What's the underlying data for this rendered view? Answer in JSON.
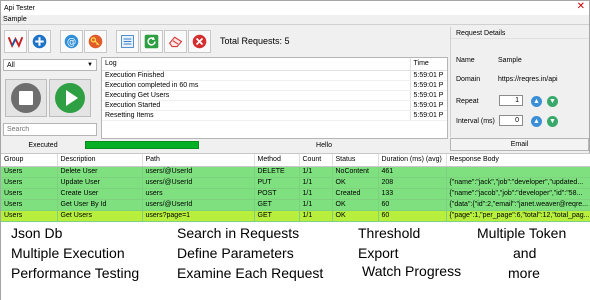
{
  "window": {
    "title": "Api Tester",
    "tab": "Sample"
  },
  "toolbar": {
    "total_requests": "Total Requests: 5"
  },
  "left": {
    "filter_value": "All",
    "search_placeholder": "Search"
  },
  "log": {
    "headers": [
      "Log",
      "Time"
    ],
    "rows": [
      [
        "Execution Finished",
        "5:59:01 P"
      ],
      [
        "Execution completed in 60 ms",
        "5:59:01 P"
      ],
      [
        "Executing Get Users",
        "5:59:01 P"
      ],
      [
        "Execution Started",
        "5:59:01 P"
      ],
      [
        "Resetting Items",
        "5:59:01 P"
      ]
    ]
  },
  "details": {
    "title": "Request Details",
    "name_label": "Name",
    "name_value": "Sample",
    "domain_label": "Domain",
    "domain_value": "https://reqres.in/api",
    "repeat_label": "Repeat",
    "repeat_value": "1",
    "interval_label": "Interval (ms)",
    "interval_value": "0",
    "email_button": "Email"
  },
  "status": {
    "executed": "Executed",
    "progress": 1.0,
    "message": "Hello"
  },
  "grid": {
    "headers": [
      "Group",
      "Description",
      "Path",
      "Method",
      "Count",
      "Status",
      "Duration (ms) (avg)",
      "Response Body"
    ],
    "rows": [
      [
        "Users",
        "Delete User",
        "users/@UserId",
        "DELETE",
        "1/1",
        "NoContent",
        "461",
        ""
      ],
      [
        "Users",
        "Update User",
        "users/@UserId",
        "PUT",
        "1/1",
        "OK",
        "208",
        "{\"name\":\"jack\",\"job\":\"developer\",\"updated..."
      ],
      [
        "Users",
        "Create User",
        "users",
        "POST",
        "1/1",
        "Created",
        "133",
        "{\"name\":\"jacob\",\"job\":\"developer\",\"id\":\"58..."
      ],
      [
        "Users",
        "Get User By Id",
        "users/@UserId",
        "GET",
        "1/1",
        "OK",
        "60",
        "{\"data\":{\"id\":2,\"email\":\"janet.weaver@reqre..."
      ],
      [
        "Users",
        "Get Users",
        "users?page=1",
        "GET",
        "1/1",
        "OK",
        "60",
        "{\"page\":1,\"per_page\":6,\"total\":12,\"total_pag..."
      ]
    ]
  },
  "features": {
    "f1": "Json Db",
    "f2": "Multiple Execution",
    "f3": "Performance Testing",
    "f4": "Search in Requests",
    "f5": "Define Parameters",
    "f6": "Examine Each Request",
    "f7": "Threshold",
    "f8": "Export",
    "f9": "Watch Progress",
    "f10": "Multiple Token",
    "f11": "and",
    "f12": "more"
  }
}
